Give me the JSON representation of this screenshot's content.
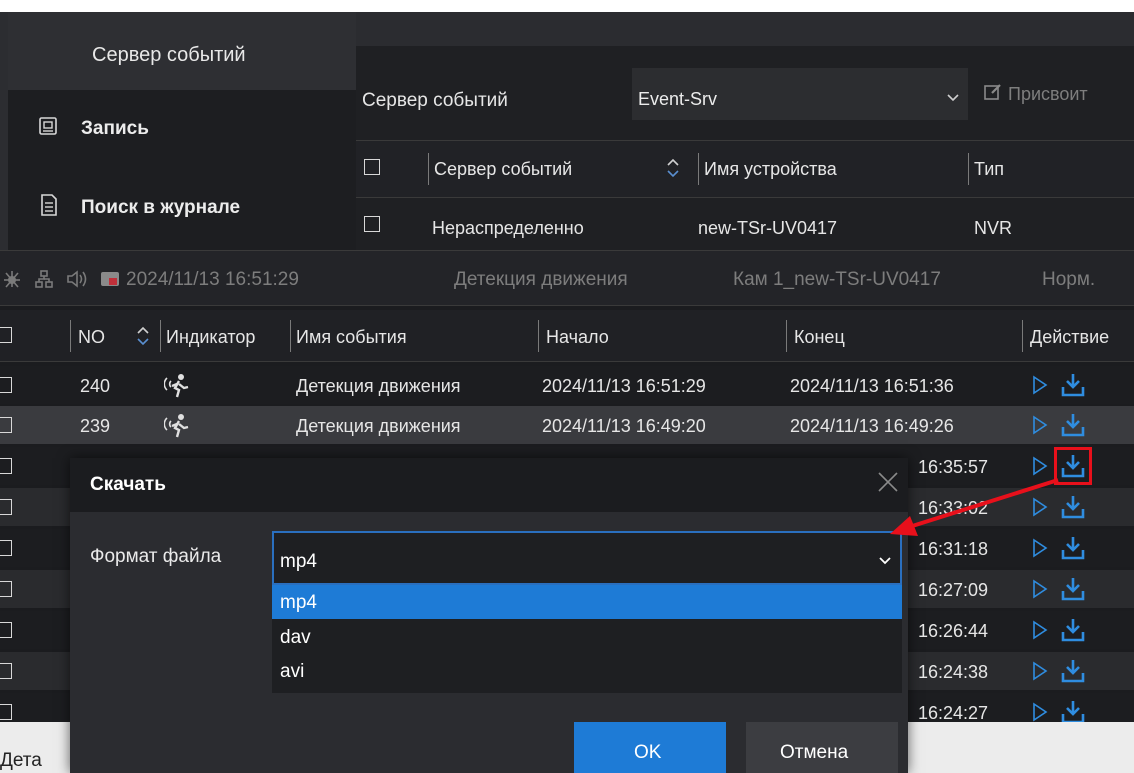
{
  "sidebar": {
    "title": "Сервер событий",
    "items": [
      {
        "label": "Запись",
        "icon": "record-icon"
      },
      {
        "label": "Поиск в журнале",
        "icon": "log-icon"
      }
    ]
  },
  "server_panel": {
    "label": "Сервер событий",
    "select_value": "Event-Srv",
    "assign_label": "Присвоит",
    "columns": [
      "Сервер событий",
      "Имя устройства",
      "Тип"
    ],
    "row": {
      "server": "Нераспределенно",
      "device": "new-TSr-UV0417",
      "type": "NVR"
    }
  },
  "status_bar": {
    "datetime": "2024/11/13 16:51:29",
    "event": "Детекция движения",
    "camera": "Кам 1_new-TSr-UV0417",
    "state": "Норм."
  },
  "event_table": {
    "columns": {
      "no": "NO",
      "indicator": "Индикатор",
      "event_name": "Имя события",
      "start": "Начало",
      "end": "Конец",
      "action": "Действие"
    },
    "rows": [
      {
        "no": "240",
        "name": "Детекция движения",
        "start": "2024/11/13 16:51:29",
        "end": "2024/11/13 16:51:36"
      },
      {
        "no": "239",
        "name": "Детекция движения",
        "start": "2024/11/13 16:49:20",
        "end": "2024/11/13 16:49:26"
      },
      {
        "end": "16:35:57"
      },
      {
        "end": "16:33:02"
      },
      {
        "end": "16:31:18"
      },
      {
        "end": "16:27:09"
      },
      {
        "end": "16:26:44"
      },
      {
        "end": "16:24:38"
      },
      {
        "end": "16:24:27"
      }
    ]
  },
  "bottom_label": "Дета",
  "dialog": {
    "title": "Скачать",
    "format_label": "Формат файла",
    "format_value": "mp4",
    "options": [
      "mp4",
      "dav",
      "avi"
    ],
    "ok_label": "OK",
    "cancel_label": "Отмена"
  },
  "colors": {
    "accent": "#1e7bd6",
    "highlight_box": "#e8101b",
    "arrow": "#e8101b",
    "bg": "#1b1c1f"
  }
}
